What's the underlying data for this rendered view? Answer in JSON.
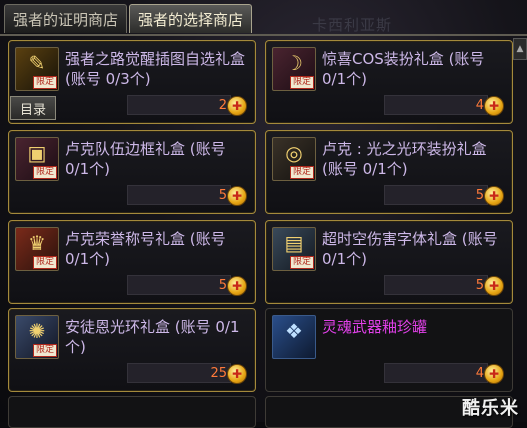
{
  "tabs": [
    {
      "label": "强者的证明商店",
      "active": false
    },
    {
      "label": "强者的选择商店",
      "active": true
    }
  ],
  "background_text": "卡西利亚斯",
  "catalog_button": "目录",
  "limited_tag": "限定",
  "items": [
    {
      "title": "强者之路觉醒插图自选礼盒(账号 0/3个)",
      "price": "2",
      "icon": "scroll-icon",
      "limited": true
    },
    {
      "title": "惊喜COS装扮礼盒 (账号 0/1个)",
      "price": "4",
      "icon": "mask-icon",
      "limited": true
    },
    {
      "title": "卢克队伍边框礼盒 (账号 0/1个)",
      "price": "5",
      "icon": "frame-icon",
      "limited": true
    },
    {
      "title": "卢克 : 光之光环装扮礼盒 (账号 0/1个)",
      "price": "5",
      "icon": "halo-icon",
      "limited": true
    },
    {
      "title": "卢克荣誉称号礼盒 (账号 0/1个)",
      "price": "5",
      "icon": "trophy-icon",
      "limited": true
    },
    {
      "title": "超时空伤害字体礼盒 (账号 0/1个)",
      "price": "5",
      "icon": "monitor-icon",
      "limited": true
    },
    {
      "title": "安徒恩光环礼盒 (账号 0/1个)",
      "price": "25",
      "icon": "ring-icon",
      "limited": true
    },
    {
      "title": "灵魂武器釉珍罐",
      "price": "4",
      "icon": "soul-jar-icon",
      "limited": false,
      "color": "#e040e8"
    }
  ],
  "currency_icon": "gold-coin-icon",
  "watermark": "酷乐米"
}
